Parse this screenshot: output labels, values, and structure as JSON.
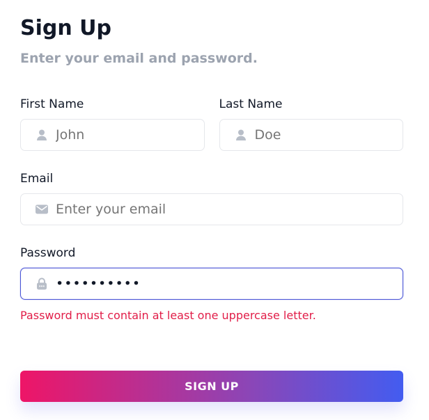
{
  "header": {
    "title": "Sign Up",
    "subtitle": "Enter your email and password."
  },
  "form": {
    "first_name": {
      "label": "First Name",
      "placeholder": "John",
      "value": ""
    },
    "last_name": {
      "label": "Last Name",
      "placeholder": "Doe",
      "value": ""
    },
    "email": {
      "label": "Email",
      "placeholder": "Enter your email",
      "value": ""
    },
    "password": {
      "label": "Password",
      "value": "••••••••••",
      "error": "Password must contain at least one uppercase letter."
    }
  },
  "actions": {
    "submit_label": "SIGN UP"
  },
  "icons": {
    "first_name": "user-icon",
    "last_name": "user-icon",
    "email": "mail-icon",
    "password": "lock-icon"
  },
  "colors": {
    "title": "#111827",
    "subtitle": "#9ca3af",
    "error": "#e11d48",
    "focus_border": "#4b55d6",
    "button_gradient_start": "#ee1567",
    "button_gradient_mid": "#8b46b7",
    "button_gradient_end": "#435cf0"
  }
}
